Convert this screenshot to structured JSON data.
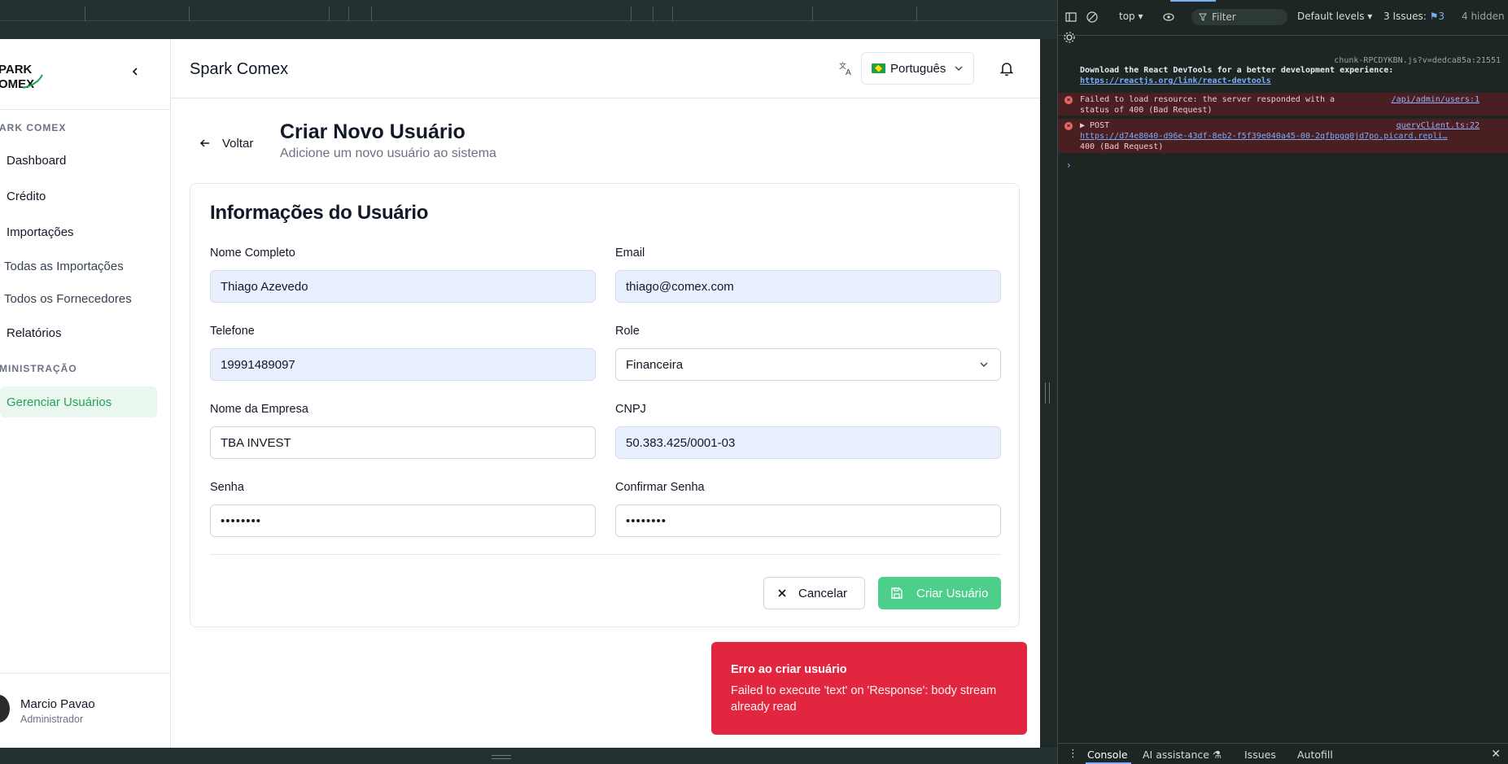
{
  "app": {
    "brand_logo_text": "SPARK COMEX",
    "title": "Spark Comex",
    "language": "Português",
    "colors": {
      "accent": "#22a35a",
      "button": "#4ccf8b",
      "toast": "#e3263f"
    }
  },
  "sidebar": {
    "section_main": "ARK COMEX",
    "items": [
      {
        "label": "Dashboard"
      },
      {
        "label": "Crédito"
      },
      {
        "label": "Importações"
      },
      {
        "label": "Todas as Importações"
      },
      {
        "label": "Todos os Fornecedores"
      },
      {
        "label": "Relatórios"
      }
    ],
    "section_admin": "MINISTRAÇÃO",
    "admin_items": [
      {
        "label": "Gerenciar Usuários"
      }
    ],
    "user": {
      "name": "Marcio Pavao",
      "role": "Administrador"
    }
  },
  "page": {
    "back_label": "Voltar",
    "title": "Criar Novo Usuário",
    "subtitle": "Adicione um novo usuário ao sistema"
  },
  "form": {
    "title": "Informações do Usuário",
    "full_name": {
      "label": "Nome Completo",
      "value": "Thiago Azevedo"
    },
    "email": {
      "label": "Email",
      "value": "thiago@comex.com"
    },
    "phone": {
      "label": "Telefone",
      "value": "19991489097"
    },
    "role": {
      "label": "Role",
      "value": "Financeira"
    },
    "company": {
      "label": "Nome da Empresa",
      "value": "TBA INVEST"
    },
    "cnpj": {
      "label": "CNPJ",
      "value": "50.383.425/0001-03"
    },
    "password": {
      "label": "Senha",
      "value": "••••••••"
    },
    "confirm_password": {
      "label": "Confirmar Senha",
      "value": "••••••••"
    },
    "cancel_label": "Cancelar",
    "submit_label": "Criar Usuário"
  },
  "toast": {
    "title": "Erro ao criar usuário",
    "description": "Failed to execute 'text' on 'Response': body stream already read"
  },
  "devtools": {
    "context": "top ▾",
    "filter_placeholder": "Filter",
    "levels": "Default levels ▾",
    "issues_label": "3 Issues:",
    "issues_count": "3",
    "hidden": "4 hidden",
    "logs": {
      "src1": "chunk-RPCDYKBN.js?v=dedca85a:21551",
      "msg1": "Download the React DevTools for a better development experience:",
      "link1": "https://reactjs.org/link/react-devtools",
      "err1_text": "Failed to load resource: the server responded with a",
      "err1_text2": "status of 400 (Bad Request)",
      "err1_src": "/api/admin/users:1",
      "err2_method": "▶ POST",
      "err2_src": "queryClient.ts:22",
      "err2_url": "https://d74e8040-d96e-43df-8eb2-f5f39e040a45-00-2qfbpgq0jd7po.picard.repli…",
      "err2_status": "400 (Bad Request)"
    },
    "tabs": [
      "Console",
      "AI assistance ⚗",
      "Issues",
      "Autofill"
    ]
  }
}
